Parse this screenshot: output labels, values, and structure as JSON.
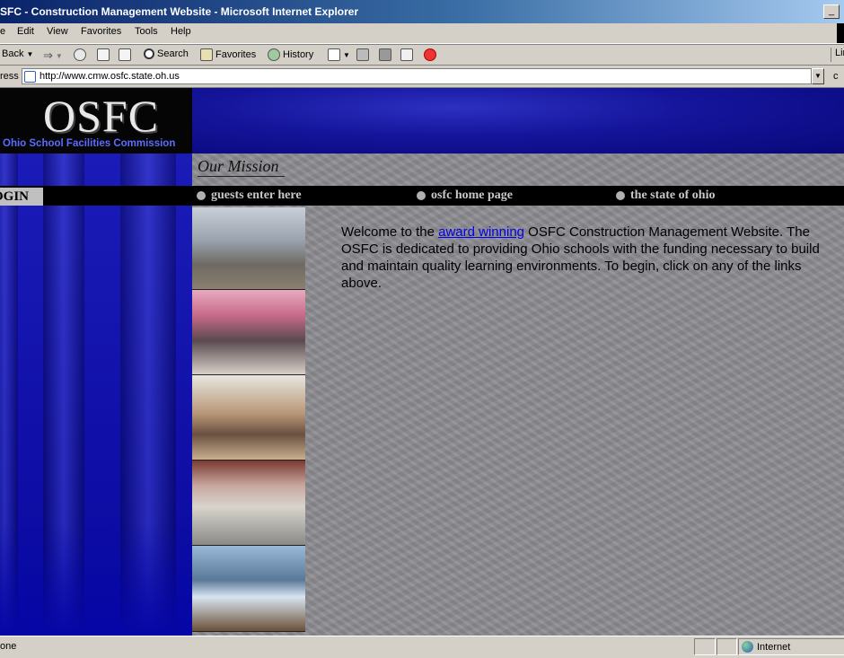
{
  "window": {
    "title": "SFC - Construction Management Website - Microsoft Internet Explorer",
    "minimize": "_"
  },
  "menu": {
    "items": [
      "e",
      "Edit",
      "View",
      "Favorites",
      "Tools",
      "Help"
    ]
  },
  "toolbar": {
    "back": "Back",
    "search": "Search",
    "favorites": "Favorites",
    "history": "History",
    "links": "Lir"
  },
  "address": {
    "label": "ress",
    "url": "http://www.cmw.osfc.state.oh.us",
    "go": "c"
  },
  "page": {
    "logo": "OSFC",
    "logo_sub": "Ohio School Facilities Commission",
    "mission": "Our Mission",
    "login": "OGIN",
    "nav": {
      "guests": "guests enter here",
      "home": "osfc home page",
      "state": "the state of ohio"
    },
    "welcome": {
      "before": "Welcome to the ",
      "link": "award winning",
      "after": " OSFC Construction Management Website. The OSFC is dedicated to providing Ohio schools with the funding necessary to build and maintain quality learning environments. To begin, click on any of the links above."
    }
  },
  "status": {
    "text": "one",
    "zone": "Internet"
  }
}
